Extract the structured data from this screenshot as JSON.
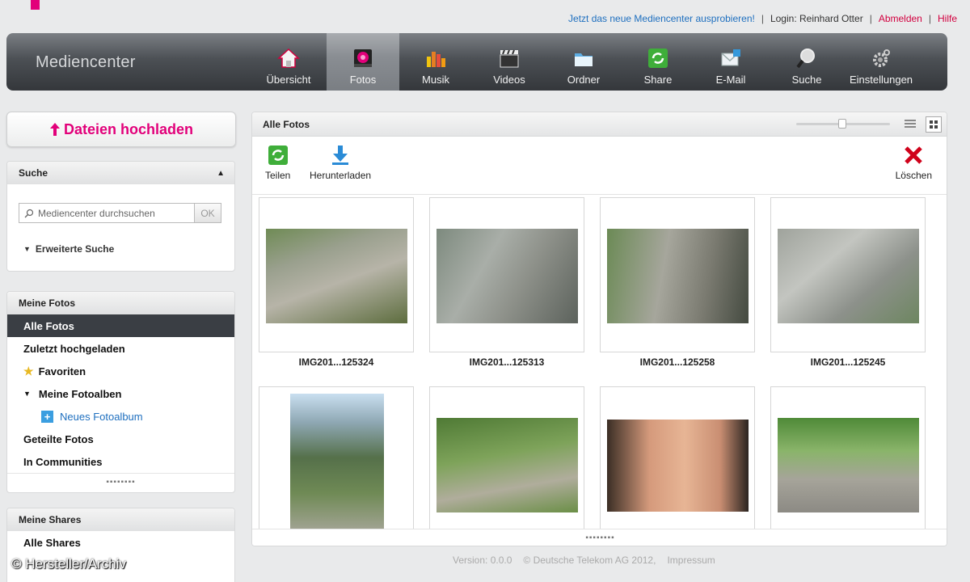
{
  "topbar": {
    "new_link": "Jetzt das neue Mediencenter ausprobieren!",
    "login": "Login: Reinhard Otter",
    "logout": "Abmelden",
    "help": "Hilfe"
  },
  "nav": {
    "brand": "Mediencenter",
    "tabs": [
      {
        "label": "Übersicht",
        "icon": "home-icon"
      },
      {
        "label": "Fotos",
        "icon": "photo-icon",
        "active": true
      },
      {
        "label": "Musik",
        "icon": "music-icon"
      },
      {
        "label": "Videos",
        "icon": "clapper-icon"
      },
      {
        "label": "Ordner",
        "icon": "folder-icon"
      },
      {
        "label": "Share",
        "icon": "share-icon"
      },
      {
        "label": "E-Mail",
        "icon": "mail-icon"
      },
      {
        "label": "Suche",
        "icon": "magnifier-icon"
      },
      {
        "label": "Einstellungen",
        "icon": "gear-icon"
      }
    ]
  },
  "sidebar": {
    "upload_label": "Dateien hochladen",
    "search": {
      "title": "Suche",
      "placeholder": "Mediencenter durchsuchen",
      "ok": "OK",
      "advanced": "Erweiterte Suche"
    },
    "photos": {
      "title": "Meine Fotos",
      "items": [
        {
          "label": "Alle Fotos"
        },
        {
          "label": "Zuletzt hochgeladen"
        },
        {
          "label": "Favoriten"
        },
        {
          "label": "Meine Fotoalben"
        },
        {
          "label": "Neues Fotoalbum"
        },
        {
          "label": "Geteilte Fotos"
        },
        {
          "label": "In Communities"
        }
      ]
    },
    "shares": {
      "title": "Meine Shares",
      "items": [
        {
          "label": "Alle Shares"
        }
      ]
    }
  },
  "main": {
    "title": "Alle Fotos",
    "toolbar": {
      "share": "Teilen",
      "download": "Herunterladen",
      "delete": "Löschen"
    },
    "photos": [
      {
        "name": "IMG201...125324"
      },
      {
        "name": "IMG201...125313"
      },
      {
        "name": "IMG201...125258"
      },
      {
        "name": "IMG201...125245"
      },
      {
        "name": ""
      },
      {
        "name": ""
      },
      {
        "name": ""
      },
      {
        "name": ""
      }
    ]
  },
  "footer": {
    "version": "Version: 0.0.0",
    "copyright": "© Deutsche Telekom AG 2012,",
    "impressum": "Impressum"
  },
  "watermark": "© Hersteller/Archiv",
  "colors": {
    "accent": "#e2007a",
    "link": "#1e6fbf",
    "nav_dark": "#3a3e44"
  }
}
